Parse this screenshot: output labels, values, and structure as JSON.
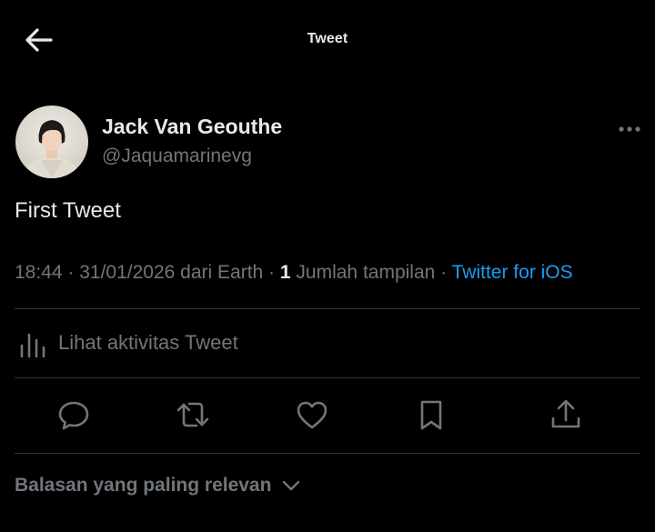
{
  "header": {
    "title": "Tweet",
    "back_icon": "arrow-left-icon"
  },
  "tweet": {
    "author": {
      "display_name": "Jack Van Geouthe",
      "handle": "@Jaquamarinevg"
    },
    "text": "First Tweet",
    "meta": {
      "time": "18:44",
      "separator": " · ",
      "date_location": "31/01/2026 dari Earth",
      "view_count": "1",
      "views_label": " Jumlah tampilan",
      "source": "Twitter for iOS"
    },
    "activity_label": "Lihat aktivitas Tweet",
    "actions": [
      "reply-icon",
      "retweet-icon",
      "like-icon",
      "bookmark-icon",
      "share-icon"
    ]
  },
  "replies": {
    "sort_label": "Balasan yang paling relevan"
  },
  "colors": {
    "background": "#000000",
    "text": "#e7e9ea",
    "muted": "#71767b",
    "accent": "#1d9bf0",
    "divider": "#2f3336"
  }
}
